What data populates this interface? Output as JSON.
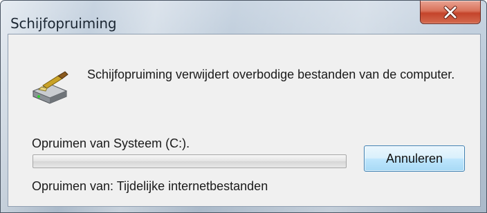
{
  "window": {
    "title": "Schijfopruiming",
    "close_icon": "close-icon"
  },
  "dialog": {
    "icon": "disk-cleanup-icon",
    "description": "Schijfopruiming verwijdert overbodige bestanden van de computer.",
    "status_label": "Opruimen van Systeem (C:).",
    "progress": 0,
    "cancel_label": "Annuleren",
    "current_item": "Opruimen van: Tijdelijke internetbestanden"
  },
  "colors": {
    "close_button": "#c4442b",
    "progress_fill": "#37b02a",
    "button_border": "#3c7fb1"
  }
}
